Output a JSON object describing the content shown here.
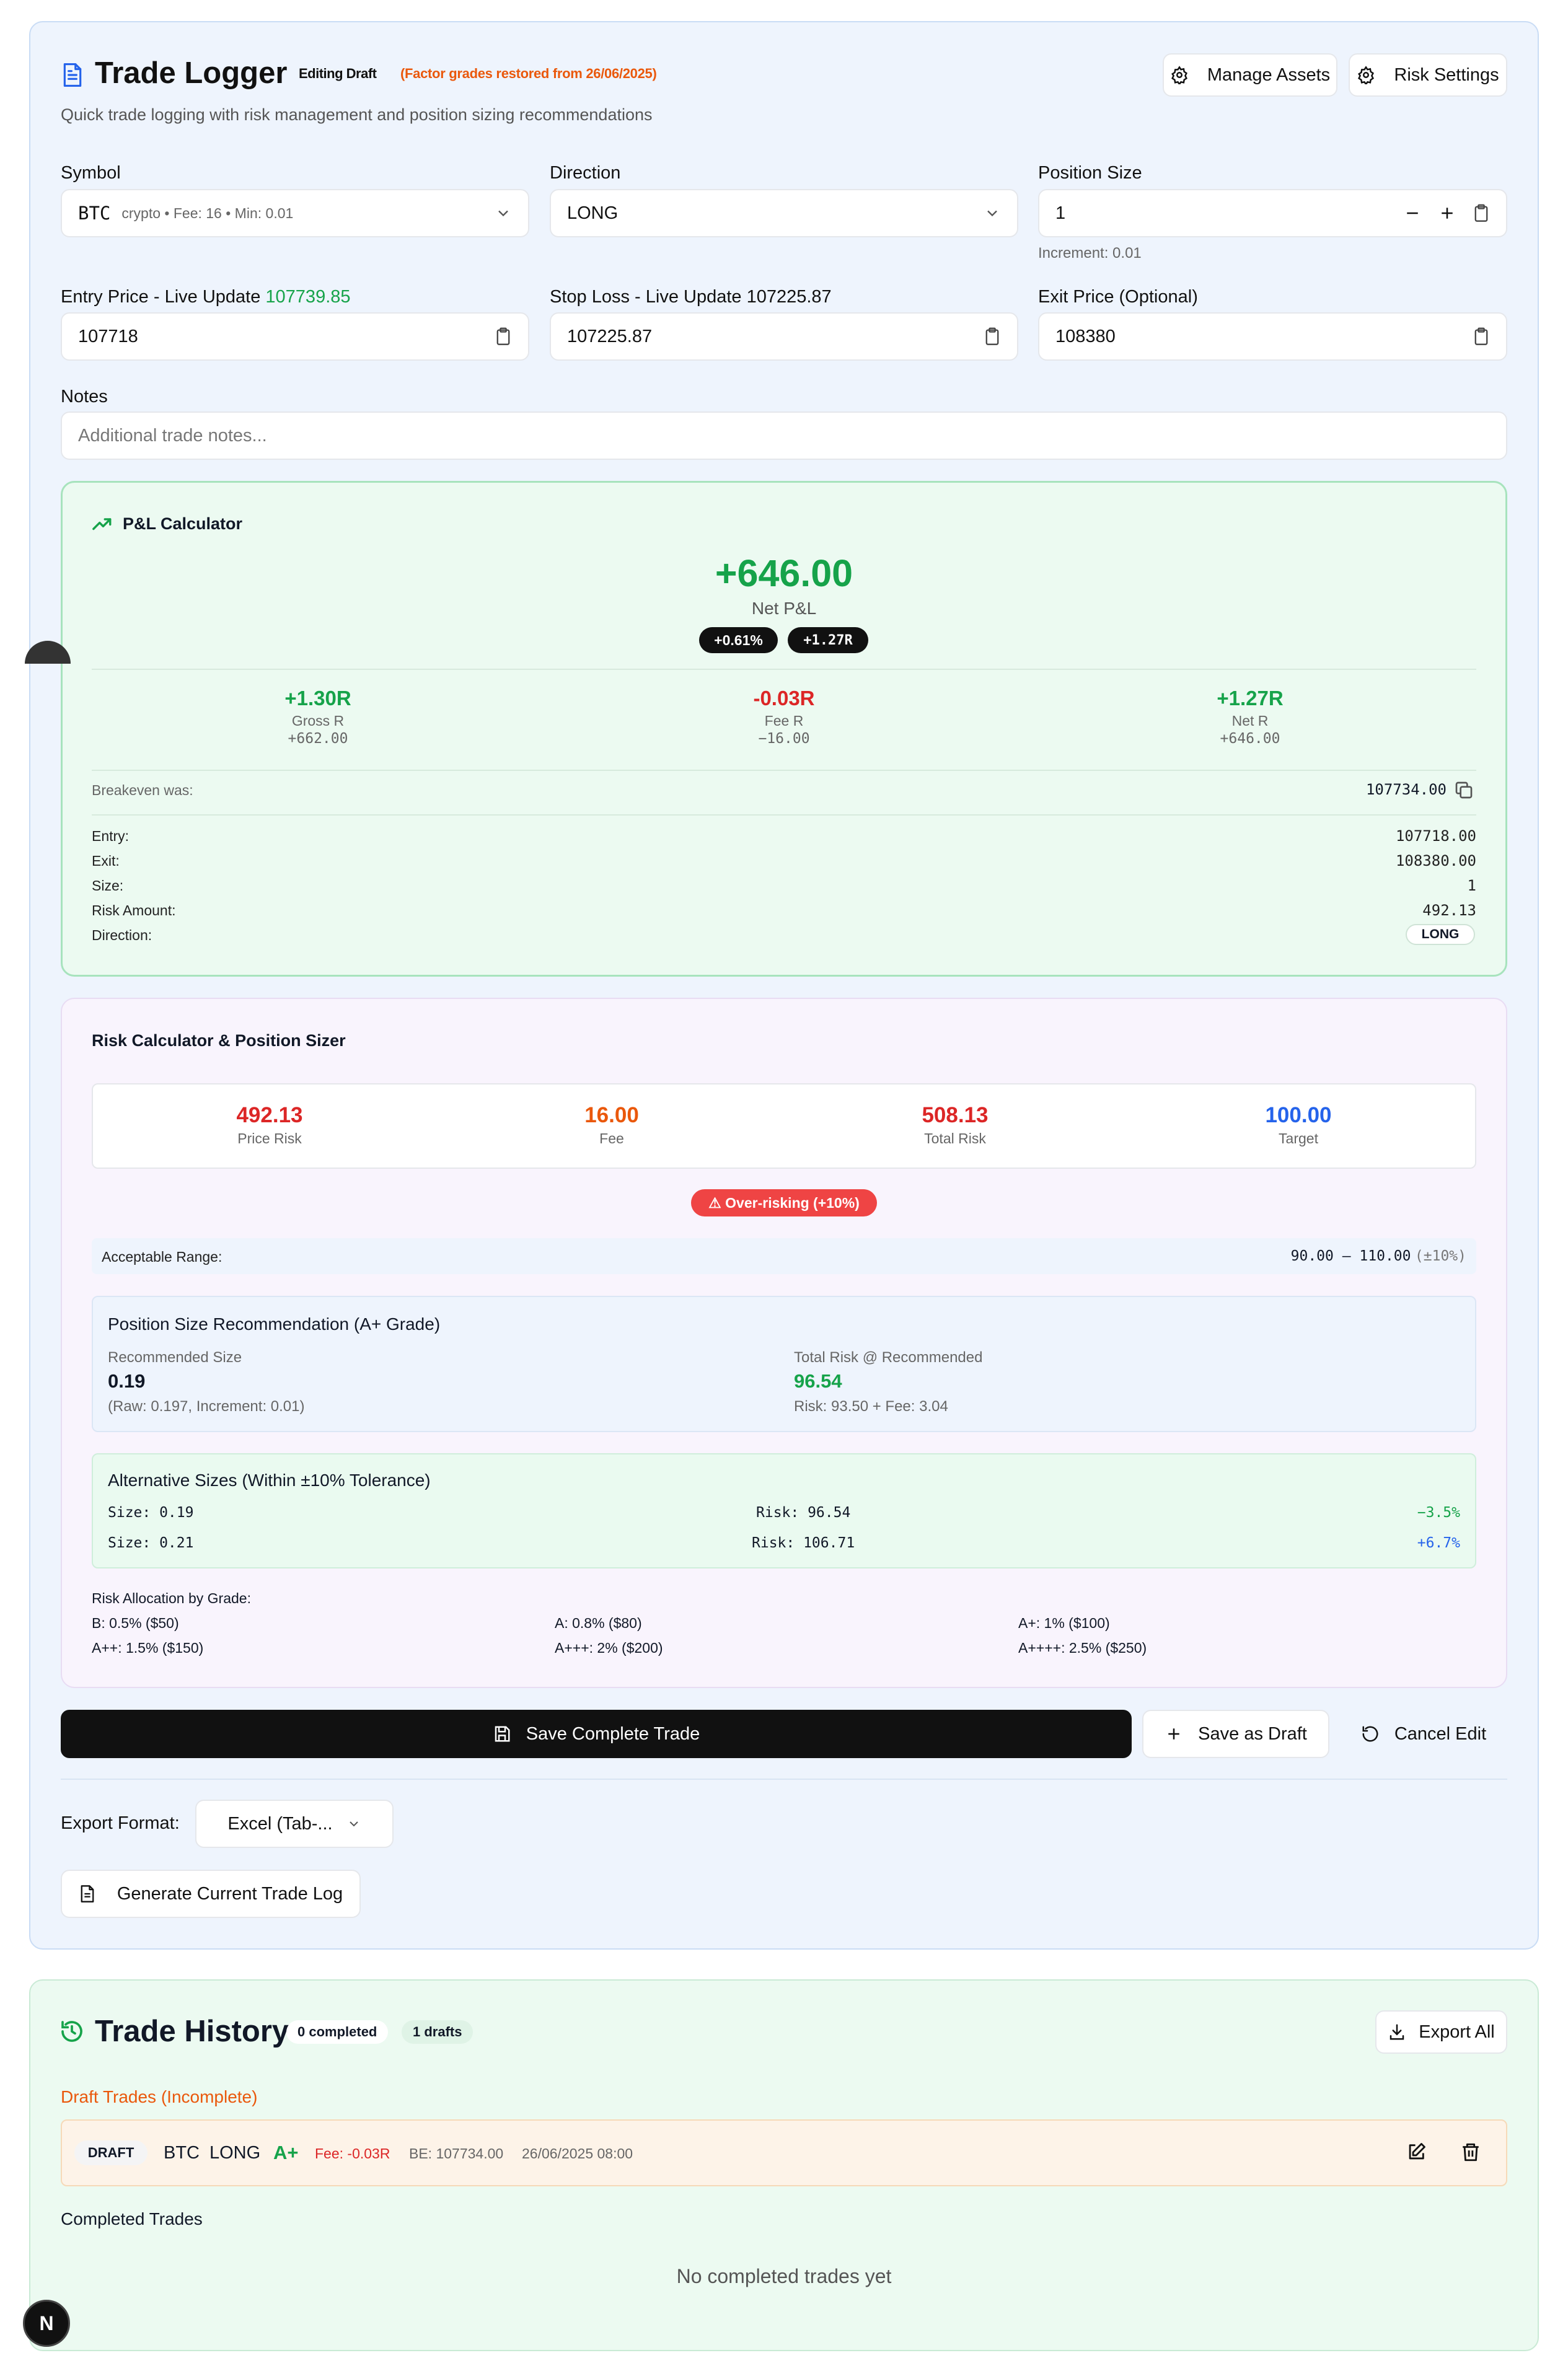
{
  "logger": {
    "title": "Trade Logger",
    "editing_badge": "Editing Draft",
    "restored_note": "(Factor grades restored from 26/06/2025)",
    "subtitle": "Quick trade logging with risk management and position sizing recommendations",
    "manage_assets": "Manage Assets",
    "risk_settings": "Risk Settings"
  },
  "form": {
    "symbol_label": "Symbol",
    "symbol_value": "BTC",
    "symbol_meta": "crypto • Fee: 16 • Min: 0.01",
    "direction_label": "Direction",
    "direction_value": "LONG",
    "position_size_label": "Position Size",
    "position_size_value": "1",
    "increment_hint": "Increment: 0.01",
    "entry_label": "Entry Price - Live Update",
    "entry_live": "107739.85",
    "entry_value": "107718",
    "stop_label": "Stop Loss - Live Update 107225.87",
    "stop_value": "107225.87",
    "exit_label": "Exit Price (Optional)",
    "exit_value": "108380",
    "notes_label": "Notes",
    "notes_placeholder": "Additional trade notes..."
  },
  "pnl": {
    "title": "P&L Calculator",
    "net_value": "+646.00",
    "net_label": "Net P&L",
    "pct_badge": "+0.61%",
    "r_badge": "+1.27R",
    "gross_r": "+1.30R",
    "gross_r_label": "Gross R",
    "gross_value": "+662.00",
    "fee_r": "-0.03R",
    "fee_r_label": "Fee R",
    "fee_value": "−16.00",
    "net_r": "+1.27R",
    "net_r_label": "Net R",
    "net_r_value": "+646.00",
    "breakeven_label": "Breakeven was:",
    "breakeven_value": "107734.00",
    "details": [
      {
        "label": "Entry:",
        "value": "107718.00"
      },
      {
        "label": "Exit:",
        "value": "108380.00"
      },
      {
        "label": "Size:",
        "value": "1"
      },
      {
        "label": "Risk Amount:",
        "value": "492.13"
      },
      {
        "label": "Direction:",
        "value": "LONG"
      }
    ]
  },
  "risk": {
    "title": "Risk Calculator & Position Sizer",
    "price_risk": "492.13",
    "price_risk_label": "Price Risk",
    "fee": "16.00",
    "fee_label": "Fee",
    "total_risk": "508.13",
    "total_risk_label": "Total Risk",
    "target": "100.00",
    "target_label": "Target",
    "warning": "⚠ Over-risking (+10%)",
    "range_label": "Acceptable Range:",
    "range_value": "90.00 – 110.00",
    "range_tol": "(±10%)",
    "rec_title": "Position Size Recommendation (A+ Grade)",
    "rec_size_label": "Recommended Size",
    "rec_size": "0.19",
    "rec_raw": "(Raw: 0.197, Increment: 0.01)",
    "rec_total_label": "Total Risk @ Recommended",
    "rec_total": "96.54",
    "rec_breakdown": "Risk: 93.50 + Fee: 3.04",
    "alt_title": "Alternative Sizes (Within ±10% Tolerance)",
    "alts": [
      {
        "size": "Size: 0.19",
        "risk": "Risk: 96.54",
        "diff": "−3.5%",
        "color": "#16a34a"
      },
      {
        "size": "Size: 0.21",
        "risk": "Risk: 106.71",
        "diff": "+6.7%",
        "color": "#2563eb"
      }
    ],
    "alloc_title": "Risk Allocation by Grade:",
    "alloc": [
      "B: 0.5% ($50)",
      "A: 0.8% ($80)",
      "A+: 1% ($100)",
      "A++: 1.5% ($150)",
      "A+++: 2% ($200)",
      "A++++: 2.5% ($250)"
    ]
  },
  "actions": {
    "save_complete": "Save Complete Trade",
    "save_draft": "Save as Draft",
    "cancel_edit": "Cancel Edit",
    "export_format_label": "Export Format:",
    "export_format_value": "Excel (Tab-...",
    "generate_log": "Generate Current Trade Log"
  },
  "history": {
    "title": "Trade History",
    "completed_badge": "0 completed",
    "drafts_badge": "1 drafts",
    "export_all": "Export All",
    "draft_heading": "Draft Trades (Incomplete)",
    "draft": {
      "tag": "DRAFT",
      "symbol": "BTC",
      "direction": "LONG",
      "grade": "A+",
      "fee": "Fee: -0.03R",
      "be": "BE: 107734.00",
      "date": "26/06/2025 08:00"
    },
    "completed_heading": "Completed Trades",
    "empty": "No completed trades yet"
  },
  "misc": {
    "dev_badge": "N"
  },
  "colors": {
    "green": "#16a34a",
    "red": "#dc2626",
    "orange": "#ea580c",
    "blue": "#2563eb"
  }
}
